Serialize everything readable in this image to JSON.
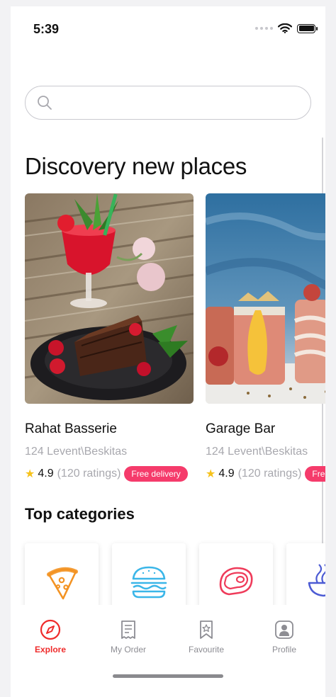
{
  "status_bar": {
    "time": "5:39"
  },
  "search": {
    "placeholder": "",
    "value": ""
  },
  "discovery": {
    "title": "Discovery new places",
    "places": [
      {
        "name": "Rahat Basserie",
        "address": "124 Levent\\Beskitas",
        "rating": "4.9",
        "ratings_count": "(120 ratings)",
        "badge": "Free delivery",
        "image": "strawberry-drink-and-chocolate-cake"
      },
      {
        "name": "Garage Bar",
        "address": "124 Levent\\Beskitas",
        "rating": "4.9",
        "ratings_count": "(120 ratings)",
        "badge": "Free delivery",
        "image": "smoothies-on-blue-background"
      }
    ]
  },
  "categories": {
    "title": "Top categories",
    "items": [
      {
        "icon": "pizza-icon",
        "color": "#f39323"
      },
      {
        "icon": "burger-icon",
        "color": "#3bb6e8"
      },
      {
        "icon": "steak-icon",
        "color": "#ef3b5a"
      },
      {
        "icon": "noodles-icon",
        "color": "#4c5bd4"
      }
    ]
  },
  "tabbar": {
    "tabs": [
      {
        "label": "Explore",
        "icon": "compass-icon",
        "active": true
      },
      {
        "label": "My Order",
        "icon": "receipt-icon",
        "active": false
      },
      {
        "label": "Favourite",
        "icon": "bookmark-icon",
        "active": false
      },
      {
        "label": "Profile",
        "icon": "profile-icon",
        "active": false
      }
    ]
  },
  "colors": {
    "accent": "#ef2b2b",
    "badge": "#f53b6b",
    "muted_text": "#a8a8ae"
  }
}
